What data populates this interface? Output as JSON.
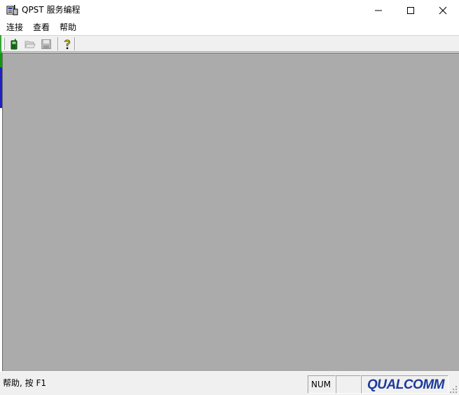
{
  "window": {
    "title": "QPST 服务编程",
    "app_icon": "qpst-phone-icon",
    "controls": [
      "minimize-icon",
      "maximize-icon",
      "close-icon"
    ]
  },
  "menu": [
    {
      "label": "连接"
    },
    {
      "label": "查看"
    },
    {
      "label": "帮助"
    }
  ],
  "toolbar": {
    "buttons": [
      {
        "icon": "phone-icon",
        "enabled": true
      },
      {
        "icon": "open-folder-icon",
        "enabled": false
      },
      {
        "icon": "save-icon",
        "enabled": false
      },
      {
        "icon": "help-icon",
        "enabled": true
      }
    ]
  },
  "client_area": {
    "background": "#ababab"
  },
  "statusbar": {
    "help_text": "帮助, 按 F1",
    "num_indicator": "NUM",
    "logo_text": "QUALCOMM",
    "logo_color": "#1c3a9c"
  }
}
